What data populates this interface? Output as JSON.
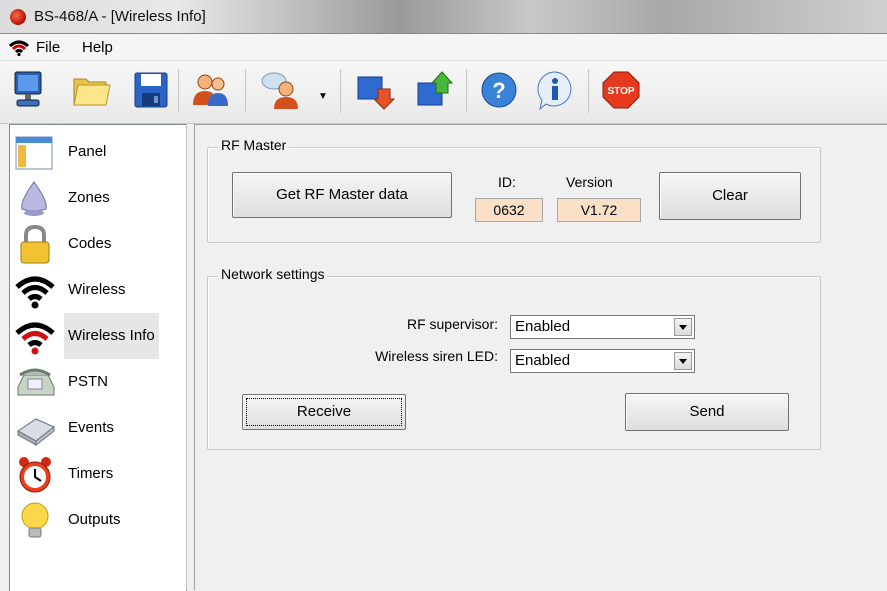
{
  "window": {
    "title": "BS-468/A - [Wireless Info]"
  },
  "menu": {
    "file": "File",
    "help": "Help"
  },
  "toolbar": {
    "buttons": [
      "computer-icon",
      "folder-icon",
      "save-icon",
      "users-icon",
      "user-speech-icon",
      "download-icon",
      "upload-icon",
      "help-icon",
      "info-icon",
      "stop-icon"
    ],
    "stop_label": "STOP"
  },
  "sidebar": {
    "items": [
      {
        "label": "Panel",
        "icon": "panel-icon"
      },
      {
        "label": "Zones",
        "icon": "zones-icon"
      },
      {
        "label": "Codes",
        "icon": "lock-icon"
      },
      {
        "label": "Wireless",
        "icon": "wireless-icon"
      },
      {
        "label": "Wireless Info",
        "icon": "wireless-info-icon"
      },
      {
        "label": "PSTN",
        "icon": "phone-icon"
      },
      {
        "label": "Events",
        "icon": "events-icon"
      },
      {
        "label": "Timers",
        "icon": "alarm-clock-icon"
      },
      {
        "label": "Outputs",
        "icon": "bulb-icon"
      }
    ],
    "active": "Wireless Info"
  },
  "rf_master": {
    "legend": "RF Master",
    "get_button": "Get RF Master data",
    "id_label": "ID:",
    "id_value": "0632",
    "version_label": "Version",
    "version_value": "V1.72",
    "clear_button": "Clear"
  },
  "network": {
    "legend": "Network settings",
    "rf_supervisor_label": "RF supervisor:",
    "rf_supervisor_value": "Enabled",
    "siren_led_label": "Wireless siren LED:",
    "siren_led_value": "Enabled",
    "receive_button": "Receive",
    "send_button": "Send"
  },
  "colors": {
    "value_box": "#fbe0c8",
    "window_bg": "#f0f0f0"
  }
}
